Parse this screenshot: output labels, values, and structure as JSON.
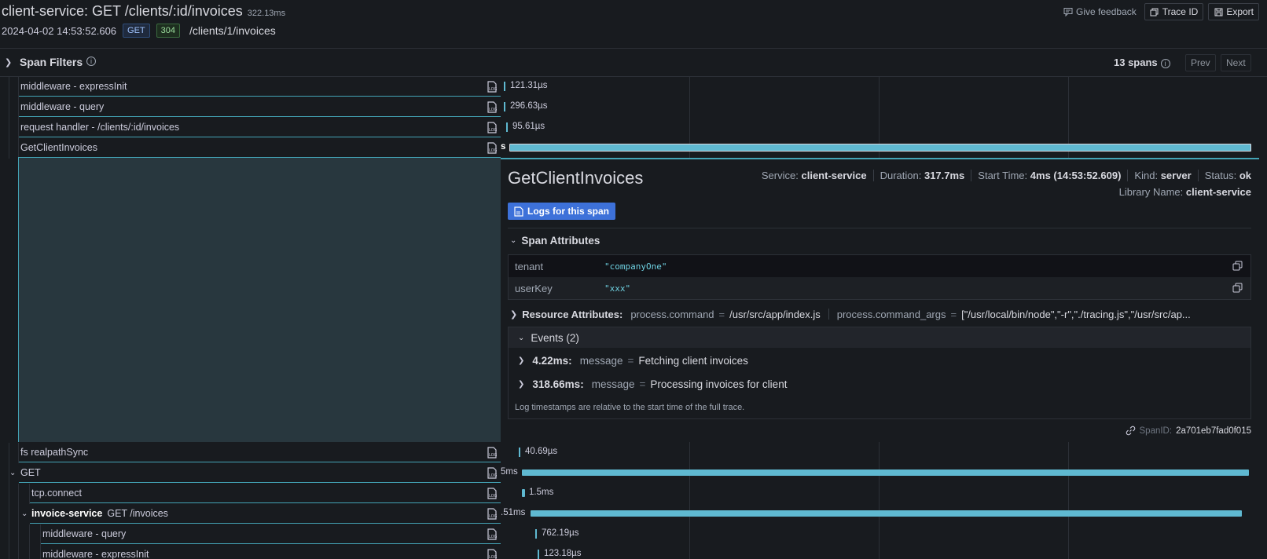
{
  "header": {
    "title": "client-service: GET /clients/:id/invoices",
    "duration": "322.13ms",
    "timestamp_main": "2024-04-02 14:53:",
    "timestamp_sec": "52.606",
    "method": "GET",
    "status": "304",
    "url": "/clients/1/invoices",
    "feedback": "Give feedback",
    "trace_id_btn": "Trace ID",
    "export_btn": "Export"
  },
  "filters": {
    "label": "Span Filters",
    "span_count": "13 spans",
    "prev": "Prev",
    "next": "Next"
  },
  "spans": [
    {
      "name": "middleware - expressInit",
      "duration": "121.31µs"
    },
    {
      "name": "middleware - query",
      "duration": "296.63µs"
    },
    {
      "name": "request handler - /clients/:id/invoices",
      "duration": "95.61µs"
    },
    {
      "name": "GetClientInvoices",
      "duration": "s"
    },
    {
      "name": "fs realpathSync",
      "duration": "40.69µs"
    },
    {
      "name": "GET",
      "duration": "5ms"
    },
    {
      "name": "tcp.connect",
      "duration": "1.5ms"
    },
    {
      "service": "invoice-service",
      "name": "GET /invoices",
      "duration": ".51ms"
    },
    {
      "name": "middleware - query",
      "duration": "762.19µs"
    },
    {
      "name": "middleware - expressInit",
      "duration": "123.18µs"
    }
  ],
  "detail": {
    "title": "GetClientInvoices",
    "service_label": "Service:",
    "service": "client-service",
    "duration_label": "Duration:",
    "duration": "317.7ms",
    "start_label": "Start Time:",
    "start": "4ms (14:53:52.609)",
    "kind_label": "Kind:",
    "kind": "server",
    "status_label": "Status:",
    "status": "ok",
    "library_label": "Library Name:",
    "library": "client-service",
    "logs_btn": "Logs for this span",
    "span_attr_title": "Span Attributes",
    "attributes": [
      {
        "key": "tenant",
        "value": "\"companyOne\""
      },
      {
        "key": "userKey",
        "value": "\"xxx\""
      }
    ],
    "resource_title": "Resource Attributes:",
    "resource": [
      {
        "key": "process.command",
        "value": "/usr/src/app/index.js"
      },
      {
        "key": "process.command_args",
        "value": "[\"/usr/local/bin/node\",\"-r\",\"./tracing.js\",\"/usr/src/ap..."
      }
    ],
    "events_title": "Events (2)",
    "events": [
      {
        "time": "4.22ms:",
        "key": "message",
        "value": "Fetching client invoices"
      },
      {
        "time": "318.66ms:",
        "key": "message",
        "value": "Processing invoices for client"
      }
    ],
    "events_note": "Log timestamps are relative to the start time of the full trace.",
    "spanid_label": "SpanID:",
    "spanid": "2a701eb7fad0f015"
  }
}
